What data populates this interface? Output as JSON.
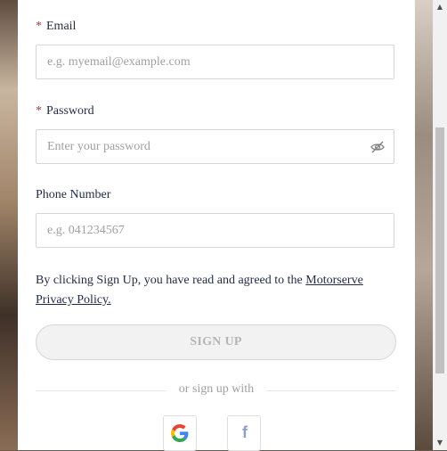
{
  "form": {
    "email": {
      "required_mark": "*",
      "label": "Email",
      "placeholder": "e.g. myemail@example.com"
    },
    "password": {
      "required_mark": "*",
      "label": "Password",
      "placeholder": "Enter your password",
      "toggle_icon": "eye-slash-icon"
    },
    "phone": {
      "label": "Phone Number",
      "placeholder": "e.g. 041234567"
    },
    "terms": {
      "text": "By clicking Sign Up, you have read and agreed to the ",
      "link": "Motorserve Privacy Policy."
    },
    "signup_button": "SIGN UP",
    "divider_text": "or sign up with",
    "social": [
      {
        "name": "google",
        "icon": "google-icon"
      },
      {
        "name": "facebook",
        "icon": "facebook-icon",
        "glyph": "f"
      }
    ]
  },
  "colors": {
    "text": "#1f2a44",
    "required": "#c4302b",
    "placeholder": "#a0a0a0",
    "button_bg": "#f2f2f2",
    "button_text": "#b5b5b5",
    "facebook": "#8da0c9"
  }
}
